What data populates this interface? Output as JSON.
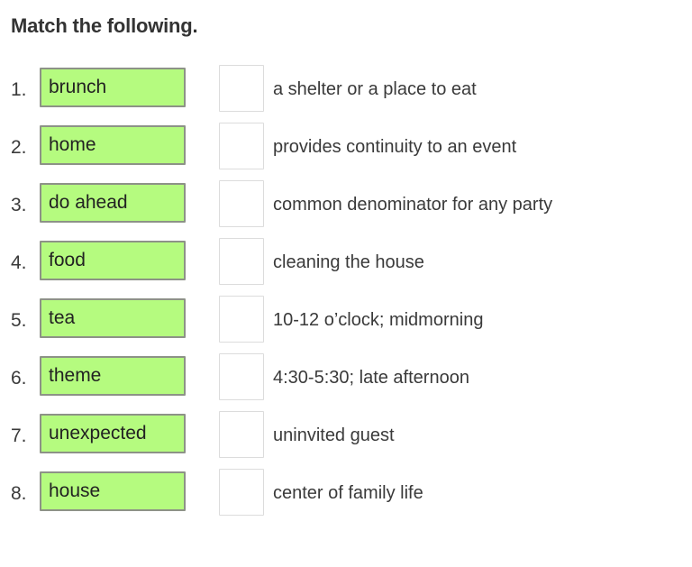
{
  "page": {
    "title": "Match the following.",
    "background_color": "#ffffff",
    "text_color": "#3a3a3a",
    "term_box_fill": "#b5fb7f",
    "term_box_border": "#8d9287",
    "answer_box_border": "#dcdcdc"
  },
  "rows": [
    {
      "number": "1.",
      "term": "brunch",
      "answer": "",
      "definition": "a shelter or a place to eat"
    },
    {
      "number": "2.",
      "term": "home",
      "answer": "",
      "definition": "provides continuity to an event"
    },
    {
      "number": "3.",
      "term": "do ahead",
      "answer": "",
      "definition": "common denominator for any party"
    },
    {
      "number": "4.",
      "term": "food",
      "answer": "",
      "definition": "cleaning the house"
    },
    {
      "number": "5.",
      "term": "tea",
      "answer": "",
      "definition": "10-12 o’clock; midmorning"
    },
    {
      "number": "6.",
      "term": "theme",
      "answer": "",
      "definition": "4:30-5:30; late afternoon"
    },
    {
      "number": "7.",
      "term": "unexpected",
      "answer": "",
      "definition": "uninvited guest"
    },
    {
      "number": "8.",
      "term": "house",
      "answer": "",
      "definition": "center of family life"
    }
  ]
}
